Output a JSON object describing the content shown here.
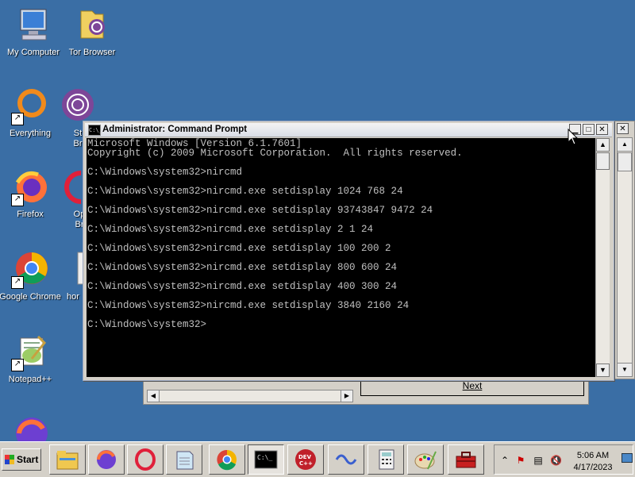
{
  "desktop": {
    "icons": [
      {
        "label": "My Computer"
      },
      {
        "label": "Tor Browser"
      },
      {
        "label": "Everything"
      },
      {
        "label": "St\nBr"
      },
      {
        "label": "Firefox"
      },
      {
        "label": "Op\nBr"
      },
      {
        "label": "Google Chrome"
      },
      {
        "label": "hor"
      },
      {
        "label": "Notepad++"
      }
    ]
  },
  "background_window": {
    "button_label": "Next"
  },
  "cmd_window": {
    "title": "Administrator: Command Prompt",
    "icon_text": "C:\\_",
    "lines": [
      "Microsoft Windows [Version 6.1.7601]",
      "Copyright (c) 2009 Microsoft Corporation.  All rights reserved.",
      "",
      "C:\\Windows\\system32>nircmd",
      "",
      "C:\\Windows\\system32>nircmd.exe setdisplay 1024 768 24",
      "",
      "C:\\Windows\\system32>nircmd.exe setdisplay 93743847 9472 24",
      "",
      "C:\\Windows\\system32>nircmd.exe setdisplay 2 1 24",
      "",
      "C:\\Windows\\system32>nircmd.exe setdisplay 100 200 2",
      "",
      "C:\\Windows\\system32>nircmd.exe setdisplay 800 600 24",
      "",
      "C:\\Windows\\system32>nircmd.exe setdisplay 400 300 24",
      "",
      "C:\\Windows\\system32>nircmd.exe setdisplay 3840 2160 24",
      "",
      "C:\\Windows\\system32>"
    ]
  },
  "taskbar": {
    "start_label": "Start",
    "clock_time": "5:06 AM",
    "clock_date": "4/17/2023",
    "apps": [
      {
        "name": "file-explorer-icon"
      },
      {
        "name": "firefox-nightly-icon"
      },
      {
        "name": "opera-icon"
      },
      {
        "name": "notepad-icon"
      },
      {
        "name": "chrome-icon"
      },
      {
        "name": "command-prompt-icon"
      },
      {
        "name": "dev-cpp-icon",
        "text": "DEV C++"
      },
      {
        "name": "visual-studio-icon"
      },
      {
        "name": "calculator-icon"
      },
      {
        "name": "paint-icon"
      },
      {
        "name": "toolbox-icon"
      }
    ]
  }
}
